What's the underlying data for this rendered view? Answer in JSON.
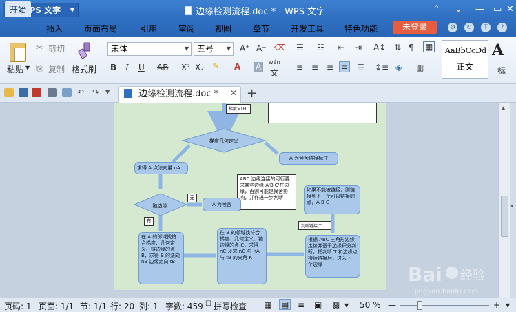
{
  "titlebar": {
    "app_name": "WPS 文字",
    "doc_title": "边缘检测流程.doc * - WPS 文字"
  },
  "menu": {
    "items": [
      "开始",
      "插入",
      "页面布局",
      "引用",
      "审阅",
      "视图",
      "章节",
      "开发工具",
      "特色功能"
    ],
    "login": "未登录"
  },
  "ribbon": {
    "paste": "粘贴",
    "cut": "剪切",
    "copy": "复制",
    "format_painter": "格式刷",
    "font_name": "宋体",
    "font_size": "五号",
    "style_preview": "AaBbCcDd",
    "style_name": "正文",
    "style_partial": "标",
    "style_big": "A",
    "bold": "B",
    "italic": "I",
    "underline": "U",
    "strike": "AB",
    "superscript": "X²",
    "subscript": "X₂",
    "phonetic_top": "wén",
    "phonetic_bottom": "文",
    "grow_font": "A⁺",
    "shrink_font": "A⁻",
    "font_color": "A"
  },
  "tabs": {
    "doc_tab": "边缘检测流程.doc *",
    "new_tab": "+"
  },
  "flowchart": {
    "top_label": "梯度>TH",
    "decision_1": "梯度几何定义",
    "right_box_1": "A 为候舍链接标注",
    "box_a": "求得 A 点法向量 nA",
    "note_abc": "ABC 边缘连接的可行要求某些边缘 A'B'C'在边缘，否则可能是候舍影响，并作进一步判断",
    "decision_2": "链边缘",
    "label_no": "无",
    "label_yes": "有",
    "right_box_2": "A 为候舍",
    "box_b": "在 A 的邻域找符合梯度、几何定义、链边缘的点 B，求得 B 的法向 nB 边缘走向 tB",
    "box_c": "在 B 的邻域找符合梯度、几何定义、链边缘的点 C，求得 nC 及求 nC 与 nA 与 tB 的夹角 K",
    "box_d": "根据 ABC 三角形边缘走势并基于边缘积分判断，把判断 T 和边缘点持续链接后，进入下一个边缘",
    "box_e": "如果不能被链接，则链接到下一个可以链接的点，A B C",
    "label_t": "判断链接 T"
  },
  "status": {
    "page_no": "页码: 1",
    "pages": "页面: 1/1",
    "section": "节: 1/1",
    "row": "行: 20",
    "col": "列: 1",
    "words": "字数: 459",
    "spell": "拼写检查",
    "zoom": "50 %"
  },
  "colors": {
    "title_blue": "#2f6fc2",
    "login_orange": "#e85d3f",
    "page_green": "#d5e9d1",
    "flow_box": "#a9c8ea"
  }
}
